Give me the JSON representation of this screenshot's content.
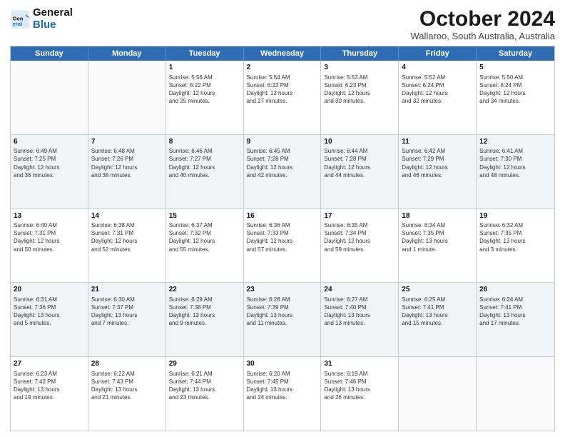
{
  "header": {
    "logo_line1": "General",
    "logo_line2": "Blue",
    "month": "October 2024",
    "location": "Wallaroo, South Australia, Australia"
  },
  "days_of_week": [
    "Sunday",
    "Monday",
    "Tuesday",
    "Wednesday",
    "Thursday",
    "Friday",
    "Saturday"
  ],
  "rows": [
    [
      {
        "day": "",
        "detail": ""
      },
      {
        "day": "",
        "detail": ""
      },
      {
        "day": "1",
        "detail": "Sunrise: 5:56 AM\nSunset: 6:22 PM\nDaylight: 12 hours\nand 25 minutes."
      },
      {
        "day": "2",
        "detail": "Sunrise: 5:54 AM\nSunset: 6:22 PM\nDaylight: 12 hours\nand 27 minutes."
      },
      {
        "day": "3",
        "detail": "Sunrise: 5:53 AM\nSunset: 6:23 PM\nDaylight: 12 hours\nand 30 minutes."
      },
      {
        "day": "4",
        "detail": "Sunrise: 5:52 AM\nSunset: 6:24 PM\nDaylight: 12 hours\nand 32 minutes."
      },
      {
        "day": "5",
        "detail": "Sunrise: 5:50 AM\nSunset: 6:24 PM\nDaylight: 12 hours\nand 34 minutes."
      }
    ],
    [
      {
        "day": "6",
        "detail": "Sunrise: 6:49 AM\nSunset: 7:25 PM\nDaylight: 12 hours\nand 36 minutes."
      },
      {
        "day": "7",
        "detail": "Sunrise: 6:48 AM\nSunset: 7:26 PM\nDaylight: 12 hours\nand 38 minutes."
      },
      {
        "day": "8",
        "detail": "Sunrise: 6:46 AM\nSunset: 7:27 PM\nDaylight: 12 hours\nand 40 minutes."
      },
      {
        "day": "9",
        "detail": "Sunrise: 6:45 AM\nSunset: 7:28 PM\nDaylight: 12 hours\nand 42 minutes."
      },
      {
        "day": "10",
        "detail": "Sunrise: 6:44 AM\nSunset: 7:28 PM\nDaylight: 12 hours\nand 44 minutes."
      },
      {
        "day": "11",
        "detail": "Sunrise: 6:42 AM\nSunset: 7:29 PM\nDaylight: 12 hours\nand 46 minutes."
      },
      {
        "day": "12",
        "detail": "Sunrise: 6:41 AM\nSunset: 7:30 PM\nDaylight: 12 hours\nand 48 minutes."
      }
    ],
    [
      {
        "day": "13",
        "detail": "Sunrise: 6:40 AM\nSunset: 7:31 PM\nDaylight: 12 hours\nand 50 minutes."
      },
      {
        "day": "14",
        "detail": "Sunrise: 6:38 AM\nSunset: 7:31 PM\nDaylight: 12 hours\nand 52 minutes."
      },
      {
        "day": "15",
        "detail": "Sunrise: 6:37 AM\nSunset: 7:32 PM\nDaylight: 12 hours\nand 55 minutes."
      },
      {
        "day": "16",
        "detail": "Sunrise: 6:36 AM\nSunset: 7:33 PM\nDaylight: 12 hours\nand 57 minutes."
      },
      {
        "day": "17",
        "detail": "Sunrise: 6:35 AM\nSunset: 7:34 PM\nDaylight: 12 hours\nand 59 minutes."
      },
      {
        "day": "18",
        "detail": "Sunrise: 6:34 AM\nSunset: 7:35 PM\nDaylight: 13 hours\nand 1 minute."
      },
      {
        "day": "19",
        "detail": "Sunrise: 6:32 AM\nSunset: 7:35 PM\nDaylight: 13 hours\nand 3 minutes."
      }
    ],
    [
      {
        "day": "20",
        "detail": "Sunrise: 6:31 AM\nSunset: 7:36 PM\nDaylight: 13 hours\nand 5 minutes."
      },
      {
        "day": "21",
        "detail": "Sunrise: 6:30 AM\nSunset: 7:37 PM\nDaylight: 13 hours\nand 7 minutes."
      },
      {
        "day": "22",
        "detail": "Sunrise: 6:29 AM\nSunset: 7:38 PM\nDaylight: 13 hours\nand 9 minutes."
      },
      {
        "day": "23",
        "detail": "Sunrise: 6:28 AM\nSunset: 7:39 PM\nDaylight: 13 hours\nand 11 minutes."
      },
      {
        "day": "24",
        "detail": "Sunrise: 6:27 AM\nSunset: 7:40 PM\nDaylight: 13 hours\nand 13 minutes."
      },
      {
        "day": "25",
        "detail": "Sunrise: 6:25 AM\nSunset: 7:41 PM\nDaylight: 13 hours\nand 15 minutes."
      },
      {
        "day": "26",
        "detail": "Sunrise: 6:24 AM\nSunset: 7:41 PM\nDaylight: 13 hours\nand 17 minutes."
      }
    ],
    [
      {
        "day": "27",
        "detail": "Sunrise: 6:23 AM\nSunset: 7:42 PM\nDaylight: 13 hours\nand 19 minutes."
      },
      {
        "day": "28",
        "detail": "Sunrise: 6:22 AM\nSunset: 7:43 PM\nDaylight: 13 hours\nand 21 minutes."
      },
      {
        "day": "29",
        "detail": "Sunrise: 6:21 AM\nSunset: 7:44 PM\nDaylight: 13 hours\nand 23 minutes."
      },
      {
        "day": "30",
        "detail": "Sunrise: 6:20 AM\nSunset: 7:45 PM\nDaylight: 13 hours\nand 24 minutes."
      },
      {
        "day": "31",
        "detail": "Sunrise: 6:19 AM\nSunset: 7:46 PM\nDaylight: 13 hours\nand 26 minutes."
      },
      {
        "day": "",
        "detail": ""
      },
      {
        "day": "",
        "detail": ""
      }
    ]
  ]
}
